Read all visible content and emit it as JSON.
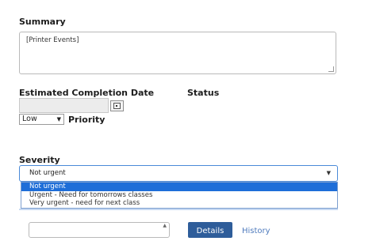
{
  "summary": {
    "label": "Summary",
    "value": "[Printer Events]"
  },
  "estimated_completion": {
    "label": "Estimated Completion Date",
    "value": "",
    "calendar_icon": "calendar-icon"
  },
  "status": {
    "label": "Status"
  },
  "priority": {
    "selected": "Low",
    "label": "Priority"
  },
  "severity": {
    "label": "Severity",
    "selected": "Not urgent",
    "options": [
      "Not urgent",
      "Urgent - Need for tomorrows classes",
      "Very urgent - need for next class"
    ]
  },
  "footer": {
    "details_label": "Details",
    "history_label": "History"
  },
  "colors": {
    "accent": "#1e6ed8",
    "button": "#2e5d9a",
    "link": "#4f7bbd"
  }
}
